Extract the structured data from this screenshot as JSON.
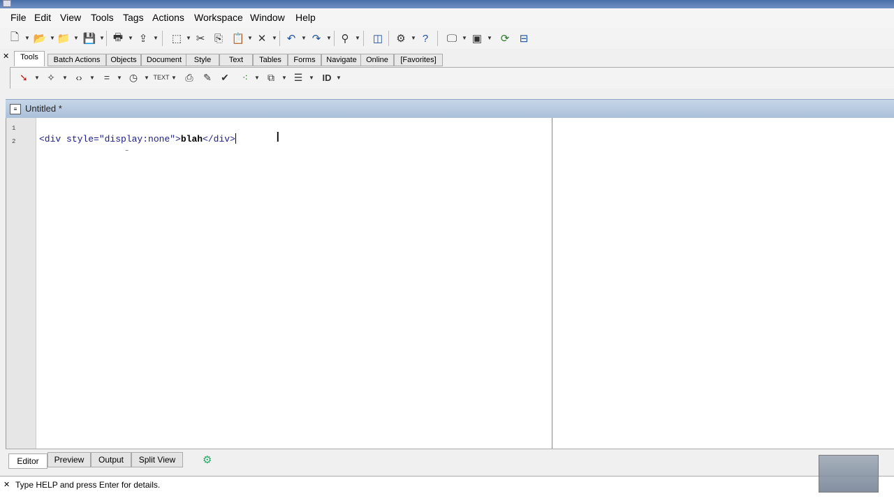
{
  "menu": {
    "items": [
      "File",
      "Edit",
      "View",
      "Tools",
      "Tags",
      "Actions",
      "Workspace",
      "Window",
      "Help"
    ]
  },
  "toolbar_tabs": [
    "Tools",
    "Batch Actions",
    "Objects",
    "Document",
    "Style",
    "Text",
    "Tables",
    "Forms",
    "Navigate",
    "Online",
    "[Favorites]"
  ],
  "toolbar_tabs_active": "Tools",
  "toolbar2": {
    "id_label": "ID"
  },
  "document": {
    "title": "Untitled *",
    "line_numbers": [
      "1",
      "2"
    ],
    "code": {
      "open_tag_start": "<div ",
      "attr_name": "style=",
      "attr_value": "\"display:none\"",
      "open_tag_end": ">",
      "text": "blah",
      "close_tag": "</div>"
    }
  },
  "bottom_tabs": [
    "Editor",
    "Preview",
    "Output",
    "Split View"
  ],
  "bottom_tabs_active": "Editor",
  "status": {
    "message": "Type HELP and press Enter for details."
  },
  "colors": {
    "panel_header": "#b8cbe1",
    "code_tag": "#1a1a8c"
  }
}
